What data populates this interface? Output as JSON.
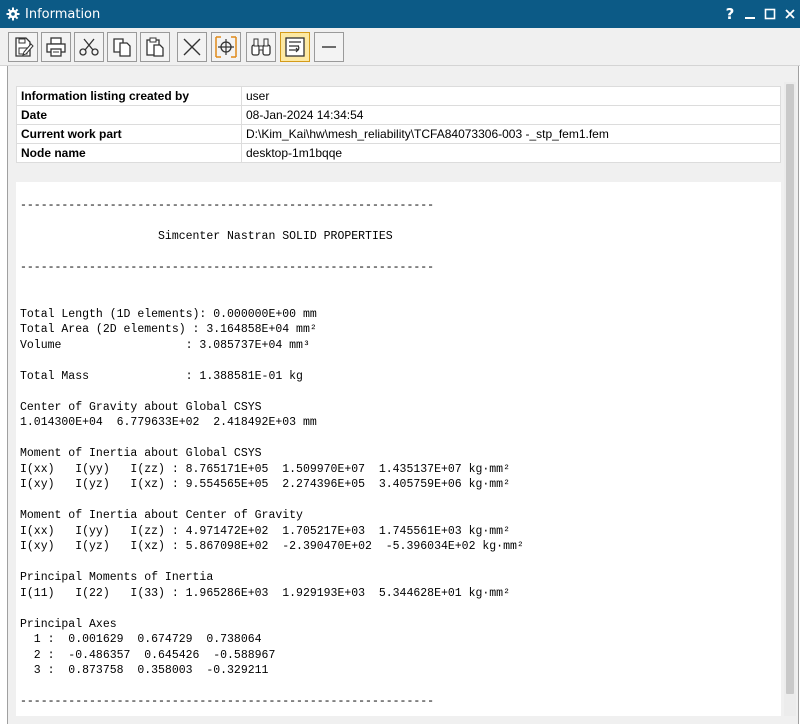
{
  "window": {
    "title": "Information",
    "help_label": "?",
    "icons": [
      "gear-icon",
      "help-icon",
      "minimize-icon",
      "maximize-icon",
      "close-icon"
    ]
  },
  "toolbar": {
    "buttons": [
      {
        "name": "save-button",
        "icon": "save-icon"
      },
      {
        "name": "print-button",
        "icon": "printer-icon"
      },
      {
        "name": "cut-button",
        "icon": "scissors-icon"
      },
      {
        "name": "copy-button",
        "icon": "copy-icon"
      },
      {
        "name": "paste-button",
        "icon": "paste-icon"
      },
      {
        "name": "clear-button",
        "icon": "x-icon"
      },
      {
        "name": "select-button",
        "icon": "crosshair-icon"
      },
      {
        "name": "find-button",
        "icon": "binoculars-icon"
      },
      {
        "name": "wrap-button",
        "icon": "wrap-icon",
        "active": true
      },
      {
        "name": "separator-button",
        "icon": "minus-icon"
      }
    ]
  },
  "info_table": {
    "rows": [
      {
        "key": "Information listing created by",
        "value": "user"
      },
      {
        "key": "Date",
        "value": "08-Jan-2024 14:34:54"
      },
      {
        "key": "Current work part",
        "value": "D:\\Kim_Kai\\hw\\mesh_reliability\\TCFA84073306-003 -_stp_fem1.fem"
      },
      {
        "key": "Node name",
        "value": "desktop-1m1bqqe"
      }
    ]
  },
  "listing": {
    "divider": "------------------------------------------------------------",
    "heading": "                    Simcenter Nastran SOLID PROPERTIES",
    "lines": [
      "Total Length (1D elements): 0.000000E+00 mm",
      "Total Area (2D elements) : 3.164858E+04 mm²",
      "Volume                  : 3.085737E+04 mm³",
      "",
      "Total Mass              : 1.388581E-01 kg",
      "",
      "Center of Gravity about Global CSYS",
      "1.014300E+04  6.779633E+02  2.418492E+03 mm",
      "",
      "Moment of Inertia about Global CSYS",
      "I(xx)   I(yy)   I(zz) : 8.765171E+05  1.509970E+07  1.435137E+07 kg·mm²",
      "I(xy)   I(yz)   I(xz) : 9.554565E+05  2.274396E+05  3.405759E+06 kg·mm²",
      "",
      "Moment of Inertia about Center of Gravity",
      "I(xx)   I(yy)   I(zz) : 4.971472E+02  1.705217E+03  1.745561E+03 kg·mm²",
      "I(xy)   I(yz)   I(xz) : 5.867098E+02  -2.390470E+02  -5.396034E+02 kg·mm²",
      "",
      "Principal Moments of Inertia",
      "I(11)   I(22)   I(33) : 1.965286E+03  1.929193E+03  5.344628E+01 kg·mm²",
      "",
      "Principal Axes",
      "  1 :  0.001629  0.674729  0.738064",
      "  2 :  -0.486357  0.645426  -0.588967",
      "  3 :  0.873758  0.358003  -0.329211"
    ]
  }
}
